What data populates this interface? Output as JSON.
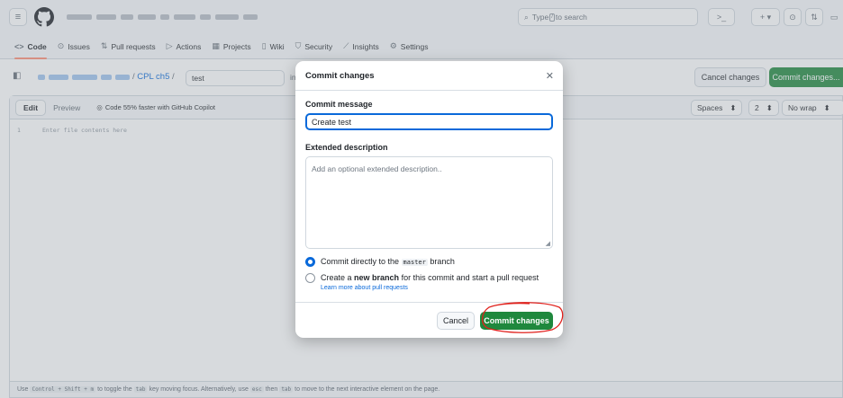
{
  "header": {
    "search_prefix": "Type",
    "search_key": "/",
    "search_suffix": "to search",
    "terminal_icon": "terminal-icon",
    "plus_label": "+ ▾"
  },
  "nav": {
    "items": [
      {
        "icon": "<>",
        "label": "Code"
      },
      {
        "icon": "⊙",
        "label": "Issues"
      },
      {
        "icon": "⇅",
        "label": "Pull requests"
      },
      {
        "icon": "▷",
        "label": "Actions"
      },
      {
        "icon": "▦",
        "label": "Projects"
      },
      {
        "icon": "▯",
        "label": "Wiki"
      },
      {
        "icon": "⛉",
        "label": "Security"
      },
      {
        "icon": "⟋",
        "label": "Insights"
      },
      {
        "icon": "⚙",
        "label": "Settings"
      }
    ]
  },
  "path": {
    "folder": "CPL ch5",
    "separator": "/",
    "file_name": "test",
    "in_text": "in",
    "cancel_label": "Cancel changes",
    "commit_label": "Commit changes..."
  },
  "editor": {
    "tab_edit": "Edit",
    "tab_preview": "Preview",
    "copilot_text": "Code 55% faster with GitHub Copilot",
    "indent_mode": "Spaces",
    "indent_size": "2",
    "wrap_mode": "No wrap",
    "line_number": "1",
    "placeholder": "Enter file contents here",
    "footer_parts": [
      "Use",
      "Control + Shift + m",
      "to toggle the",
      "tab",
      "key moving focus. Alternatively, use",
      "esc",
      "then",
      "tab",
      "to move to the next interactive element on the page."
    ]
  },
  "dialog": {
    "title": "Commit changes",
    "message_label": "Commit message",
    "message_value": "Create test",
    "description_label": "Extended description",
    "description_placeholder": "Add an optional extended description..",
    "option1_prefix": "Commit directly to the",
    "option1_branch": "master",
    "option1_suffix": "branch",
    "option2_prefix": "Create a",
    "option2_bold": "new branch",
    "option2_suffix": "for this commit and start a pull request",
    "learn_more": "Learn more about pull requests",
    "cancel_label": "Cancel",
    "commit_label": "Commit changes"
  },
  "colors": {
    "accent_blue": "#0969da",
    "primary_green": "#1f883d",
    "annotation_red": "#e0201b"
  }
}
